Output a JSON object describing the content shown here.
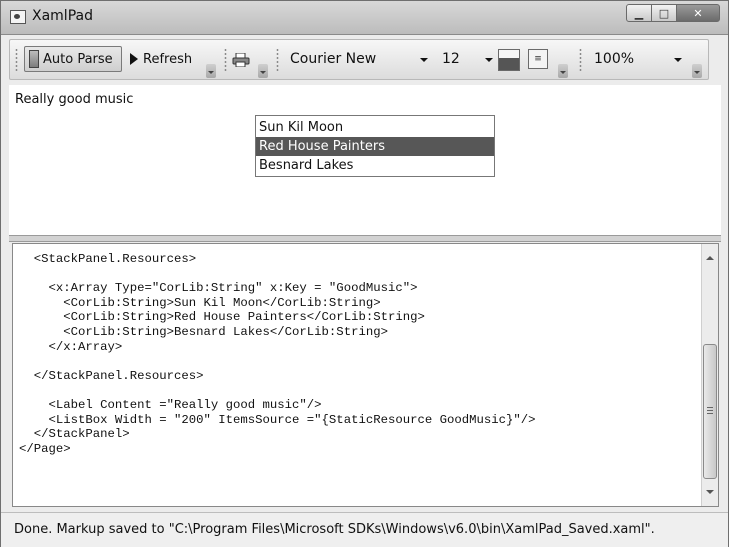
{
  "window": {
    "title": "XamlPad"
  },
  "toolbar": {
    "auto_parse_label": "Auto Parse",
    "refresh_label": "Refresh",
    "font_family": "Courier New",
    "font_size": "12",
    "zoom": "100%"
  },
  "preview": {
    "label": "Really good music",
    "list_items": [
      "Sun Kil Moon",
      "Red House Painters",
      "Besnard Lakes"
    ],
    "selected_item": "Red House Painters"
  },
  "editor": {
    "code": "  <StackPanel.Resources>\n\n    <x:Array Type=\"CorLib:String\" x:Key = \"GoodMusic\">\n      <CorLib:String>Sun Kil Moon</CorLib:String>\n      <CorLib:String>Red House Painters</CorLib:String>\n      <CorLib:String>Besnard Lakes</CorLib:String>\n    </x:Array>\n\n  </StackPanel.Resources>\n\n    <Label Content =\"Really good music\"/>\n    <ListBox Width = \"200\" ItemsSource =\"{StaticResource GoodMusic}\"/>\n  </StackPanel>\n</Page>"
  },
  "status": {
    "text": "Done. Markup saved to \"C:\\Program Files\\Microsoft SDKs\\Windows\\v6.0\\bin\\XamlPad_Saved.xaml\"."
  },
  "icons": {
    "app": "xamlpad-app-icon",
    "minimize": "minimize-icon",
    "maximize": "maximize-icon",
    "close": "close-icon",
    "auto_parse": "auto-parse-icon",
    "refresh": "play-arrow-icon",
    "print": "print-icon",
    "color": "color-picker-icon",
    "wrap": "word-wrap-icon"
  },
  "colors": {
    "selection": "#575757",
    "titlebar": "#c8c8c8"
  }
}
